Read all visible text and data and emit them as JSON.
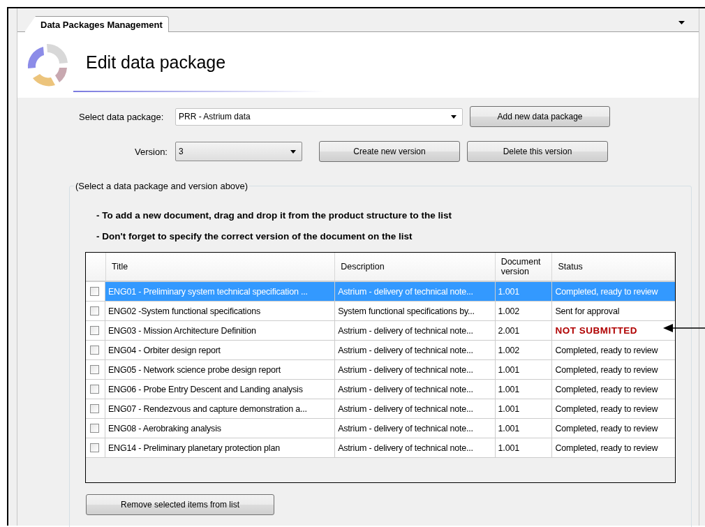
{
  "tab": {
    "label": "Data Packages Management",
    "selected": true
  },
  "header": {
    "title": "Edit data package"
  },
  "package": {
    "label": "Select data package:",
    "value": "PRR - Astrium data"
  },
  "version": {
    "label": "Version:",
    "value": "3"
  },
  "buttons": {
    "add": "Add new data package",
    "create": "Create new version",
    "delete": "Delete this version",
    "remove": "Remove selected items from list"
  },
  "group": {
    "legend": "(Select a data package and version above)",
    "instructions": [
      "- To add a new document, drag and drop it from the product structure to the list",
      "- Don't forget to specify the correct version of the document on the list"
    ]
  },
  "table": {
    "columns": [
      "Title",
      "Description",
      "Document version",
      "Status"
    ],
    "rows": [
      {
        "checked": false,
        "selected": true,
        "title": "ENG01 - Preliminary system technical specification ...",
        "description": "Astrium - delivery of technical note...",
        "version": "1.001",
        "status": "Completed, ready to review",
        "kind": "normal"
      },
      {
        "checked": false,
        "selected": false,
        "title": "ENG02 -System functional specifications",
        "description": "System functional specifications by...",
        "version": "1.002",
        "status": "Sent for approval",
        "kind": "normal"
      },
      {
        "checked": false,
        "selected": false,
        "title": "ENG03 - Mission Architecture Definition",
        "description": "Astrium - delivery of technical note...",
        "version": "2.001",
        "status": "NOT SUBMITTED",
        "kind": "alert"
      },
      {
        "checked": false,
        "selected": false,
        "title": "ENG04 - Orbiter design report",
        "description": "Astrium - delivery of technical note...",
        "version": "1.002",
        "status": "Completed, ready to review",
        "kind": "normal"
      },
      {
        "checked": false,
        "selected": false,
        "title": "ENG05 - Network science probe design report",
        "description": "Astrium - delivery of technical note...",
        "version": "1.001",
        "status": "Completed, ready to review",
        "kind": "normal"
      },
      {
        "checked": false,
        "selected": false,
        "title": "ENG06 - Probe Entry Descent and Landing analysis",
        "description": "Astrium - delivery of technical note...",
        "version": "1.001",
        "status": "Completed, ready to review",
        "kind": "normal"
      },
      {
        "checked": false,
        "selected": false,
        "title": "ENG07 - Rendezvous and capture demonstration a...",
        "description": "Astrium - delivery of technical note...",
        "version": "1.001",
        "status": "Completed, ready to review",
        "kind": "normal"
      },
      {
        "checked": false,
        "selected": false,
        "title": "ENG08 - Aerobraking analysis",
        "description": "Astrium - delivery of technical note...",
        "version": "1.001",
        "status": "Completed, ready to review",
        "kind": "normal"
      },
      {
        "checked": false,
        "selected": false,
        "title": "ENG14 - Preliminary planetary protection plan",
        "description": "Astrium - delivery of technical note...",
        "version": "1.001",
        "status": "Completed, ready to review",
        "kind": "normal"
      }
    ]
  }
}
